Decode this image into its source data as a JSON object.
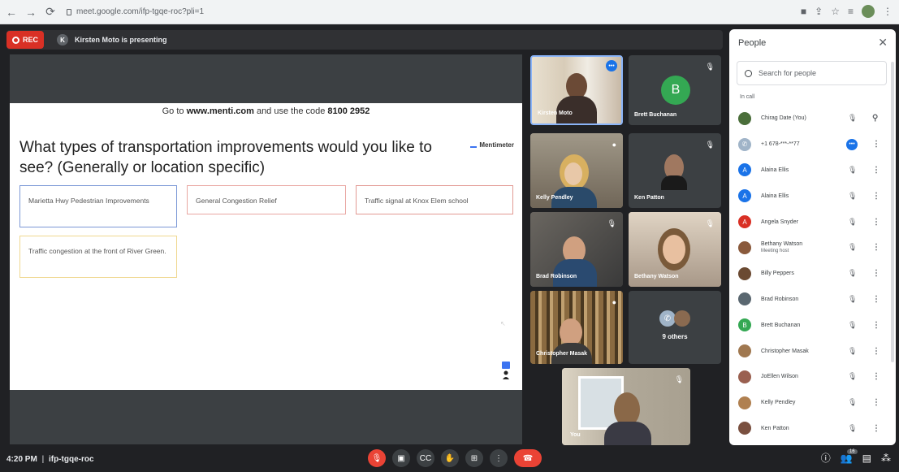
{
  "browser": {
    "url": "meet.google.com/ifp-tgqe-roc?pli=1",
    "icons": [
      "back-arrow-icon",
      "forward-arrow-icon",
      "reload-icon",
      "lock-icon",
      "camera-icon",
      "share-icon",
      "star-icon",
      "extensions-icon",
      "profile-avatar",
      "menu-dots-icon"
    ]
  },
  "topbar": {
    "rec_label": "REC",
    "presenter_initial": "K",
    "presenting_text": "Kirsten Moto is presenting"
  },
  "slide": {
    "instruction_prefix": "Go to ",
    "instruction_site": "www.menti.com",
    "instruction_mid": " and use the code ",
    "instruction_code": "8100 2952",
    "question": "What types of transportation improvements would you like to see? (Generally or location specific)",
    "brand": "Mentimeter",
    "cards": [
      "Marietta Hwy Pedestrian Improvements",
      "General Congestion Relief",
      "Traffic signal at Knox Elem school",
      "Traffic congestion at the front of River Green."
    ]
  },
  "tiles": [
    {
      "name": "Kirsten Moto",
      "type": "video"
    },
    {
      "name": "Brett Buchanan",
      "type": "avatar",
      "initial": "B",
      "color": "#34a853"
    },
    {
      "name": "Kelly Pendley",
      "type": "video"
    },
    {
      "name": "Ken Patton",
      "type": "video"
    },
    {
      "name": "Brad Robinson",
      "type": "video"
    },
    {
      "name": "Bethany Watson",
      "type": "video"
    },
    {
      "name": "Christopher Masak",
      "type": "video"
    },
    {
      "name": "9 others",
      "type": "group"
    },
    {
      "name": "You",
      "type": "video"
    }
  ],
  "bottombar": {
    "time": "4:20 PM",
    "separator": "|",
    "meeting_code": "ifp-tgqe-roc",
    "people_count": "16"
  },
  "people_panel": {
    "title": "People",
    "search_placeholder": "Search for people",
    "section_label": "In call",
    "people": [
      {
        "name": "Chirag Date (You)",
        "avatar": "photo",
        "color": "#4a6e3a"
      },
      {
        "name": "+1 678-***-**77",
        "avatar": "phone",
        "color": "#a0b4c8"
      },
      {
        "name": "Alaina Ellis",
        "avatar": "A",
        "color": "#1a73e8"
      },
      {
        "name": "Alaina Ellis",
        "avatar": "A",
        "color": "#1a73e8"
      },
      {
        "name": "Angela Snyder",
        "avatar": "A",
        "color": "#d93025"
      },
      {
        "name": "Bethany Watson",
        "sub": "Meeting host",
        "avatar": "photo",
        "color": "#8a5a3c"
      },
      {
        "name": "Billy Peppers",
        "avatar": "photo",
        "color": "#6b4a32"
      },
      {
        "name": "Brad Robinson",
        "avatar": "photo",
        "color": "#5a6770"
      },
      {
        "name": "Brett Buchanan",
        "avatar": "B",
        "color": "#34a853"
      },
      {
        "name": "Christopher Masak",
        "avatar": "photo",
        "color": "#a07850"
      },
      {
        "name": "JoEllen Wilson",
        "avatar": "photo",
        "color": "#9a6050"
      },
      {
        "name": "Kelly Pendley",
        "avatar": "photo",
        "color": "#b08050"
      },
      {
        "name": "Ken Patton",
        "avatar": "photo",
        "color": "#7a5040"
      }
    ]
  }
}
